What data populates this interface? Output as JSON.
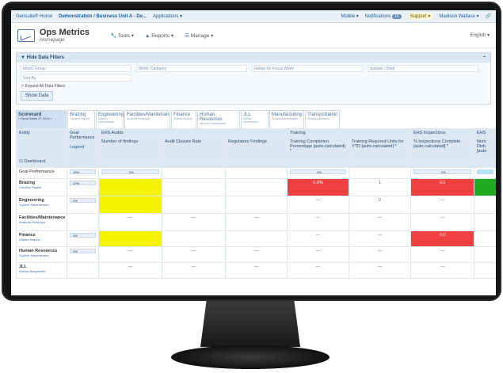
{
  "topbar": {
    "brand": "Gensuite® Home",
    "crumb": "Demonstration / Business Unit A - De...",
    "apps": "Applications ▾",
    "mobile": "Mobile ▾",
    "notifications": "Notifications",
    "notif_count": "16",
    "support": "Support ▾",
    "user": "Madison Wallace ▾",
    "link_icon": "link-icon"
  },
  "header": {
    "title": "Ops Metrics",
    "subtitle": "Homepage",
    "menu": [
      "Tools ▾",
      "Reports ▾",
      "Manage ▾"
    ],
    "language": "English ▾"
  },
  "filters": {
    "title": "Hide Data Filters",
    "row1": [
      "Metric Group",
      "Metric Category",
      "Rollup for Fiscal Week",
      "Subsite / Dept"
    ],
    "row2": [
      "Sort By"
    ],
    "expand": "Expand All Data Filters",
    "show_button": "Show Data"
  },
  "tabs": [
    {
      "label": "Scorecard",
      "sub": "‹ Fiscal Week 27 2019 ›"
    },
    {
      "label": "Brazing",
      "sub": "Caroline Rigaldi"
    },
    {
      "label": "Engineering",
      "sub": "System Administrator"
    },
    {
      "label": "Facilities/Maintenan",
      "sub": "Amanda Fleisinger"
    },
    {
      "label": "Finance",
      "sub": "Shaina Hashim"
    },
    {
      "label": "Human Resources",
      "sub": "System Administrator"
    },
    {
      "label": "JLL",
      "sub": "Marisa Manyweath"
    },
    {
      "label": "Manufacturing",
      "sub": "System Administrator"
    },
    {
      "label": "Transportation",
      "sub": "Rachitha Ramesh"
    }
  ],
  "table": {
    "group_headers": [
      "EHS Audits",
      "Training",
      "EHS Inspections",
      "EHS"
    ],
    "col_entity": "Entity",
    "col_goal": "Goal Performance",
    "legend": "Legend",
    "dashboard": "Dashboard",
    "columns": [
      "Number of findings",
      "Audit Closure Rate",
      "Regulatory Findings",
      "Training Completion Percentage [auto-calculated] *",
      "Training Required Units for YTD [auto-calculated] *",
      "% Inspections Complete [auto-calculated] *",
      "Num Disb [auto"
    ],
    "rows": [
      {
        "name": "Goal Performance",
        "sub": "",
        "goal": "10%",
        "cells": [
          "0%",
          "",
          "",
          "0%",
          "",
          "0%",
          ""
        ]
      },
      {
        "name": "Brazing",
        "sub": "Caroline Rigaldi",
        "goal": "10%",
        "cells": [
          "",
          "",
          "",
          "0.0%",
          "1",
          "0.0",
          ""
        ]
      },
      {
        "name": "Engineering",
        "sub": "System Administrator",
        "goal": "3%",
        "cells": [
          "",
          "",
          "",
          "—",
          "0",
          "—",
          ""
        ]
      },
      {
        "name": "Facilities/Maintenance",
        "sub": "Amanda Fleisinger",
        "goal": "",
        "cells": [
          "—",
          "—",
          "—",
          "—",
          "—",
          "—",
          ""
        ]
      },
      {
        "name": "Finance",
        "sub": "Shaina Hashim",
        "goal": "3%",
        "cells": [
          "",
          "",
          "",
          "—",
          "—",
          "0.0",
          ""
        ]
      },
      {
        "name": "Human Resources",
        "sub": "System Administrator",
        "goal": "3%",
        "cells": [
          "—",
          "—",
          "—",
          "—",
          "—",
          "—",
          ""
        ]
      },
      {
        "name": "JLL",
        "sub": "Marisa Manyweath",
        "goal": "",
        "cells": [
          "—",
          "—",
          "—",
          "—",
          "—",
          "—",
          ""
        ]
      }
    ]
  }
}
